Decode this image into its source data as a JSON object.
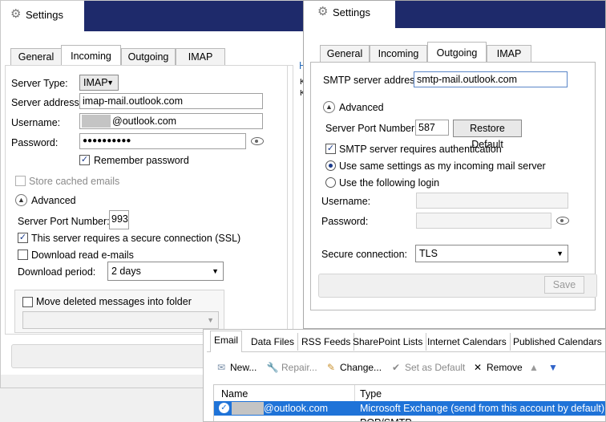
{
  "left": {
    "title": "Settings",
    "tabs": [
      "General",
      "Incoming",
      "Outgoing",
      "IMAP"
    ],
    "server_type_label": "Server Type:",
    "server_type_value": "IMAP",
    "server_address_label": "Server address:",
    "server_address_value": "imap-mail.outlook.com",
    "username_label": "Username:",
    "username_value": "@outlook.com",
    "password_label": "Password:",
    "password_value": "●●●●●●●●●●",
    "remember_password": "Remember password",
    "store_cached": "Store cached emails",
    "advanced": "Advanced",
    "port_label": "Server Port Number:",
    "port_value": "993",
    "ssl": "This server requires a secure connection (SSL)",
    "download_read": "Download read e-mails",
    "download_period_label": "Download period:",
    "download_period_value": "2 days",
    "move_deleted": "Move deleted messages into folder"
  },
  "right": {
    "title": "Settings",
    "tabs": [
      "General",
      "Incoming",
      "Outgoing",
      "IMAP"
    ],
    "smtp_label": "SMTP server address",
    "smtp_value": "smtp-mail.outlook.com",
    "advanced": "Advanced",
    "port_label": "Server Port Number:",
    "port_value": "587",
    "restore_default": "Restore Default",
    "smtp_auth": "SMTP server requires authentication",
    "use_same": "Use same settings as my incoming mail server",
    "use_following": "Use the following login",
    "username_label": "Username:",
    "password_label": "Password:",
    "secure_label": "Secure connection:",
    "secure_value": "TLS",
    "save": "Save"
  },
  "accounts": {
    "tabs": [
      "Email",
      "Data Files",
      "RSS Feeds",
      "SharePoint Lists",
      "Internet Calendars",
      "Published Calendars"
    ],
    "toolbar": [
      "New...",
      "Repair...",
      "Change...",
      "Set as Default",
      "Remove"
    ],
    "col_name": "Name",
    "col_type": "Type",
    "row_name": "@outlook.com",
    "row_type": "Microsoft Exchange (send from this account by default)",
    "row2_name": "",
    "row2_type": "POP/SMTP"
  }
}
